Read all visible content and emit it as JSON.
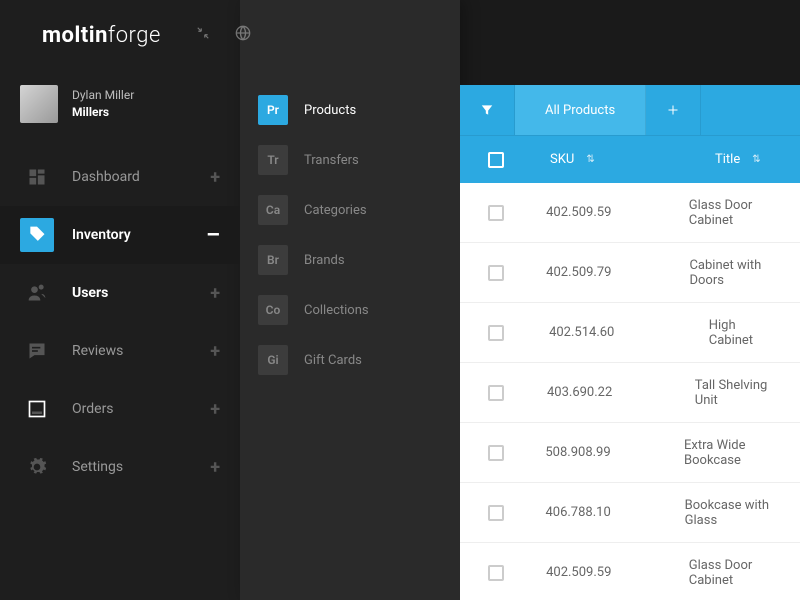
{
  "brand": {
    "bold": "moltin",
    "light": "forge"
  },
  "user": {
    "name": "Dylan Miller",
    "company": "Millers"
  },
  "nav": [
    {
      "label": "Dashboard",
      "action": "+",
      "icon": "dashboard"
    },
    {
      "label": "Inventory",
      "action": "–",
      "icon": "tag",
      "active": true
    },
    {
      "label": "Users",
      "action": "+",
      "icon": "users",
      "bold": true
    },
    {
      "label": "Reviews",
      "action": "+",
      "icon": "chat"
    },
    {
      "label": "Orders",
      "action": "+",
      "icon": "box"
    },
    {
      "label": "Settings",
      "action": "+",
      "icon": "gear"
    }
  ],
  "sub": [
    {
      "abbr": "Pr",
      "label": "Products",
      "active": true
    },
    {
      "abbr": "Tr",
      "label": "Transfers"
    },
    {
      "abbr": "Ca",
      "label": "Categories"
    },
    {
      "abbr": "Br",
      "label": "Brands"
    },
    {
      "abbr": "Co",
      "label": "Collections"
    },
    {
      "abbr": "Gi",
      "label": "Gift Cards"
    }
  ],
  "tabs": {
    "active": "All Products"
  },
  "columns": {
    "sku": "SKU",
    "title": "Title"
  },
  "rows": [
    {
      "sku": "402.509.59",
      "title": "Glass Door Cabinet"
    },
    {
      "sku": "402.509.79",
      "title": "Cabinet with Doors"
    },
    {
      "sku": "402.514.60",
      "title": "High Cabinet"
    },
    {
      "sku": "403.690.22",
      "title": "Tall Shelving Unit"
    },
    {
      "sku": "508.908.99",
      "title": "Extra Wide Bookcase"
    },
    {
      "sku": "406.788.10",
      "title": "Bookcase with Glass"
    },
    {
      "sku": "402.509.59",
      "title": "Glass Door Cabinet"
    }
  ]
}
